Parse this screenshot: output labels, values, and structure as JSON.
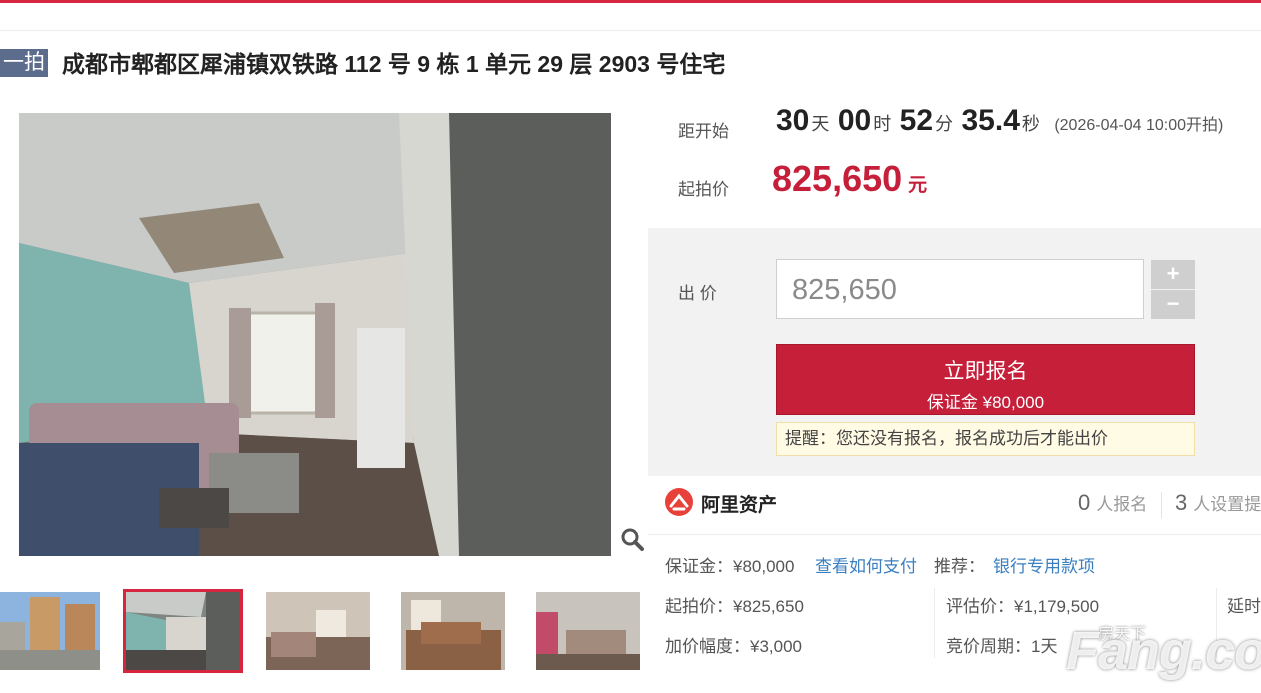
{
  "auction": {
    "tag": "一拍",
    "title": "成都市郫都区犀浦镇双铁路 112 号 9 栋 1 单元 29 层 2903 号住宅"
  },
  "countdown": {
    "label": "距开始",
    "days": "30",
    "days_unit": "天",
    "hours": "00",
    "hours_unit": "时",
    "minutes": "52",
    "minutes_unit": "分",
    "seconds": "35.4",
    "seconds_unit": "秒",
    "start_time": "(2026-04-04 10:00开拍)"
  },
  "start_price": {
    "label": "起拍价",
    "value": "825,650",
    "currency": "元"
  },
  "bid": {
    "label": "出 价",
    "value": "825,650",
    "plus": "+",
    "minus": "−"
  },
  "signup": {
    "main": "立即报名",
    "deposit": "保证金 ¥80,000",
    "notice": "提醒：您还没有报名，报名成功后才能出价"
  },
  "org": {
    "name": "阿里资产",
    "registered_count": "0",
    "registered_label": "人报名",
    "reminder_count": "3",
    "reminder_label": "人设置提"
  },
  "details": {
    "deposit": "保证金：¥80,000",
    "pay_link": "查看如何支付",
    "recommend_label": "推荐：",
    "recommend_link": "银行专用款项",
    "start_price": "起拍价：¥825,650",
    "appraisal": "评估价：¥1,179,500",
    "delay": "延时",
    "increment": "加价幅度：¥3,000",
    "cycle": "竞价周期：1天"
  },
  "gallery": {
    "zoom_icon": "magnifier-icon",
    "thumbnails": [
      "thumb-1",
      "thumb-2",
      "thumb-3",
      "thumb-4",
      "thumb-5"
    ],
    "selected": 2
  },
  "watermark": {
    "brand": "Fang.com",
    "cn": "房天下"
  },
  "colors": {
    "accent": "#c51f3a",
    "tag_bg": "#5b6c8c",
    "link": "#3a7fc1"
  }
}
